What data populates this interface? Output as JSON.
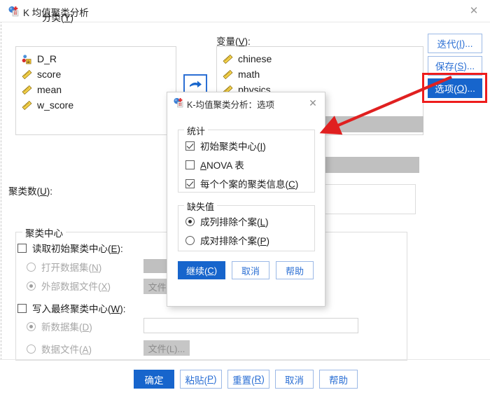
{
  "main_window": {
    "title": "K 均值聚类分析",
    "title_icon": "spss-kmeans-icon",
    "close_label": "✕",
    "source_variables": [
      {
        "name": "D_R",
        "icon": "nominal-string-icon"
      },
      {
        "name": "score",
        "icon": "scale-ruler-icon"
      },
      {
        "name": "mean",
        "icon": "scale-ruler-icon"
      },
      {
        "name": "w_score",
        "icon": "scale-ruler-icon"
      }
    ],
    "variables_label": "变量(V):",
    "variables_label_plain": "变量(",
    "variables_label_key": "V",
    "variables_label_tail": "):",
    "target_variables": [
      {
        "name": "chinese",
        "icon": "scale-ruler-icon"
      },
      {
        "name": "math",
        "icon": "scale-ruler-icon"
      },
      {
        "name": "physics",
        "icon": "scale-ruler-icon"
      }
    ],
    "move_button_icon": "arrow-right-blue-icon",
    "side_buttons": [
      {
        "text": "迭代(",
        "key": "I",
        "tail": ")..."
      },
      {
        "text": "保存(",
        "key": "S",
        "tail": ")..."
      },
      {
        "text": "选项(",
        "key": "O",
        "tail": ")..."
      }
    ],
    "classify_only_label_tail": "分类(",
    "classify_only_key": "Y",
    "classify_only_close": ")",
    "cluster_count_label": "聚类数(",
    "cluster_count_key": "U",
    "cluster_count_tail": "):",
    "centers_group_legend": "聚类中心",
    "read_initial_label": "读取初始聚类中心(",
    "read_initial_key": "E",
    "read_initial_tail": "):",
    "read_initial_checked": false,
    "open_dataset_label": "打开数据集(",
    "open_dataset_key": "N",
    "open_dataset_tail": ")",
    "open_dataset_selected": false,
    "external_file_label": "外部数据文件(",
    "external_file_key": "X",
    "external_file_tail": ")",
    "external_file_selected": true,
    "external_file_button": "文件(L)...",
    "write_final_label": "写入最终聚类中心(",
    "write_final_key": "W",
    "write_final_tail": "):",
    "write_final_checked": false,
    "new_dataset_label": "新数据集(",
    "new_dataset_key": "D",
    "new_dataset_tail": ")",
    "new_dataset_selected": true,
    "new_dataset_value": "",
    "data_file_label": "数据文件(",
    "data_file_key": "A",
    "data_file_tail": ")",
    "data_file_selected": false,
    "data_file_button": "文件(L)...",
    "bottom_buttons": {
      "ok": "确定",
      "paste": "粘贴(",
      "paste_key": "P",
      "paste_tail": ")",
      "reset": "重置(",
      "reset_key": "R",
      "reset_tail": ")",
      "cancel": "取消",
      "help": "帮助"
    }
  },
  "options_dialog": {
    "title": "K-均值聚类分析：选项",
    "title_icon": "spss-kmeans-icon",
    "close_label": "✕",
    "statistics_legend": "统计",
    "statistics_items": [
      {
        "label": "初始聚类中心(",
        "key": "I",
        "tail": ")",
        "checked": true
      },
      {
        "label": "",
        "key": "A",
        "tail": "NOVA 表",
        "checked": false,
        "key_first": true
      },
      {
        "label": "每个个案的聚类信息(",
        "key": "C",
        "tail": ")",
        "checked": true
      }
    ],
    "missing_legend": "缺失值",
    "missing_items": [
      {
        "label": "成列排除个案(",
        "key": "L",
        "tail": ")",
        "selected": true
      },
      {
        "label": "成对排除个案(",
        "key": "P",
        "tail": ")",
        "selected": false
      }
    ],
    "buttons": {
      "continue": "继续(",
      "continue_key": "C",
      "continue_tail": ")",
      "cancel": "取消",
      "help": "帮助"
    }
  },
  "annotation": {
    "highlight_color": "#ee1c1c",
    "arrow_color": "#e02020",
    "target": "选项(O)... 按钮"
  }
}
